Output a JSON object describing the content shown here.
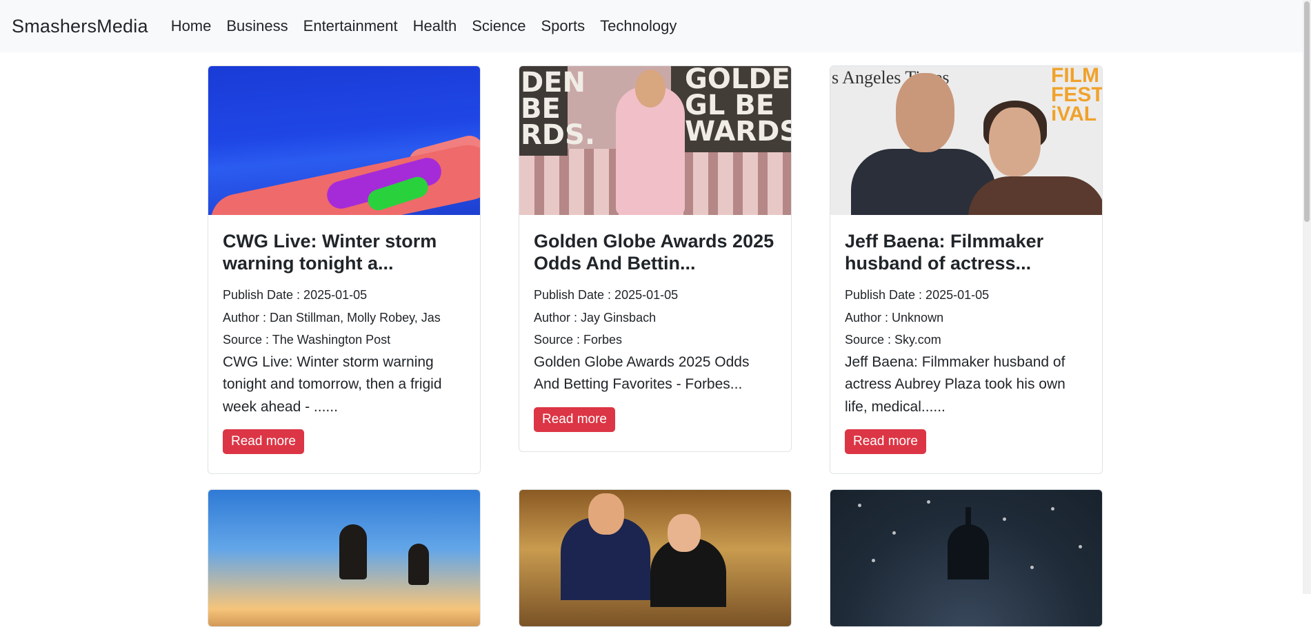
{
  "nav": {
    "brand": "SmashersMedia",
    "links": [
      "Home",
      "Business",
      "Entertainment",
      "Health",
      "Science",
      "Sports",
      "Technology"
    ]
  },
  "cards": [
    {
      "title": "CWG Live: Winter storm warning tonight a...",
      "publish_date": "Publish Date : 2025-01-05",
      "author": "Author : Dan Stillman, Molly Robey, Jas",
      "source": "Source : The Washington Post",
      "excerpt": "CWG Live: Winter storm warning tonight and tomorrow, then a frigid week ahead - ......",
      "button": "Read more"
    },
    {
      "title": "Golden Globe Awards 2025 Odds And Bettin...",
      "publish_date": "Publish Date : 2025-01-05",
      "author": "Author : Jay Ginsbach",
      "source": "Source : Forbes",
      "excerpt": "Golden Globe Awards 2025 Odds And Betting Favorites - Forbes...",
      "button": "Read more"
    },
    {
      "title": "Jeff Baena: Filmmaker husband of actress...",
      "publish_date": "Publish Date : 2025-01-05",
      "author": "Author : Unknown",
      "source": "Source : Sky.com",
      "excerpt": "Jeff Baena: Filmmaker husband of actress Aubrey Plaza took his own life, medical......",
      "button": "Read more"
    }
  ],
  "image_text": {
    "awards_left": "DEN BE RDS.",
    "awards_right": "GOLDEN GL BE WARDS.",
    "fest": "FILM FEST iVAL",
    "la_times": "s Angeles Times"
  },
  "colors": {
    "button": "#dc3545",
    "navbar": "#f8f9fa"
  }
}
